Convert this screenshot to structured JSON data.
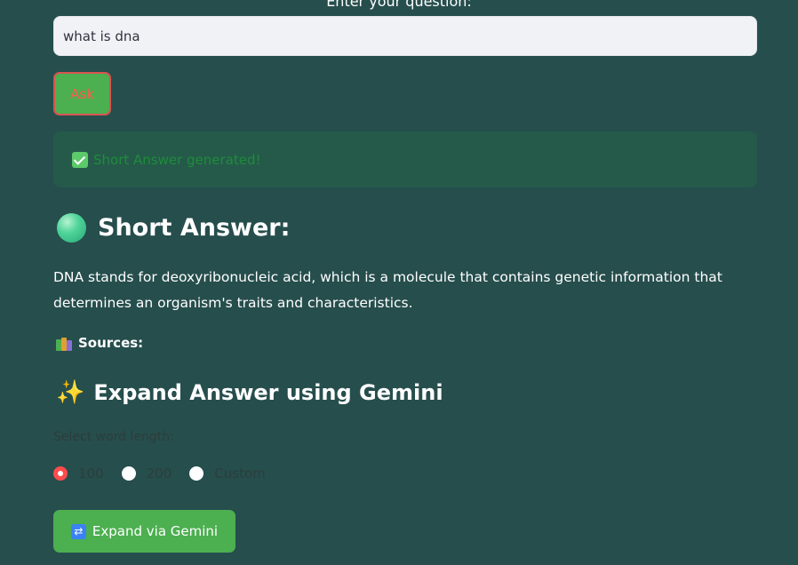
{
  "question": {
    "label": "Enter your question:",
    "value": "what is dna"
  },
  "ask_button": {
    "label": "Ask"
  },
  "status": {
    "message": "Short Answer generated!",
    "icon": "check-icon"
  },
  "short_answer": {
    "heading": "Short Answer:",
    "icon": "green-ball-icon",
    "text": "DNA stands for deoxyribonucleic acid, which is a molecule that contains genetic information that determines an organism's traits and characteristics."
  },
  "sources": {
    "label": "Sources:",
    "icon": "books-icon"
  },
  "expand": {
    "heading": "Expand Answer using Gemini",
    "icon": "sparkles-icon",
    "word_length_label": "Select word length:",
    "options": [
      "100",
      "200",
      "Custom"
    ],
    "selected_option": "100",
    "button_label": "Expand via Gemini",
    "button_icon": "refresh-icon"
  },
  "colors": {
    "background": "#264e4d",
    "button_green": "#4caf50",
    "radio_selected": "#ff4b4b"
  }
}
